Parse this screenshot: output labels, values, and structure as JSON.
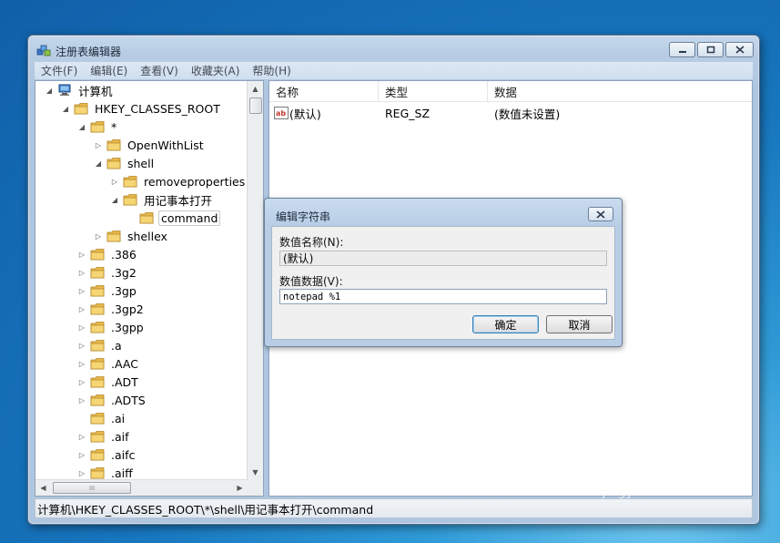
{
  "window": {
    "title": "注册表编辑器",
    "menu": [
      "文件(F)",
      "编辑(E)",
      "查看(V)",
      "收藏夹(A)",
      "帮助(H)"
    ]
  },
  "tree": [
    {
      "label": "计算机",
      "expander": "◢",
      "icon": "computer",
      "depth": 0
    },
    {
      "label": "HKEY_CLASSES_ROOT",
      "expander": "◢",
      "icon": "folder",
      "depth": 1
    },
    {
      "label": "*",
      "expander": "◢",
      "icon": "folder",
      "depth": 2
    },
    {
      "label": "OpenWithList",
      "expander": "▷",
      "icon": "folder",
      "depth": 3
    },
    {
      "label": "shell",
      "expander": "◢",
      "icon": "folder",
      "depth": 3
    },
    {
      "label": "removeproperties",
      "expander": "▷",
      "icon": "folder",
      "depth": 4
    },
    {
      "label": "用记事本打开",
      "expander": "◢",
      "icon": "folder",
      "depth": 4
    },
    {
      "label": "command",
      "expander": "",
      "icon": "folder",
      "depth": 5,
      "selected": true
    },
    {
      "label": "shellex",
      "expander": "▷",
      "icon": "folder",
      "depth": 3
    },
    {
      "label": ".386",
      "expander": "▷",
      "icon": "folder",
      "depth": 2
    },
    {
      "label": ".3g2",
      "expander": "▷",
      "icon": "folder",
      "depth": 2
    },
    {
      "label": ".3gp",
      "expander": "▷",
      "icon": "folder",
      "depth": 2
    },
    {
      "label": ".3gp2",
      "expander": "▷",
      "icon": "folder",
      "depth": 2
    },
    {
      "label": ".3gpp",
      "expander": "▷",
      "icon": "folder",
      "depth": 2
    },
    {
      "label": ".a",
      "expander": "▷",
      "icon": "folder",
      "depth": 2
    },
    {
      "label": ".AAC",
      "expander": "▷",
      "icon": "folder",
      "depth": 2
    },
    {
      "label": ".ADT",
      "expander": "▷",
      "icon": "folder",
      "depth": 2
    },
    {
      "label": ".ADTS",
      "expander": "▷",
      "icon": "folder",
      "depth": 2
    },
    {
      "label": ".ai",
      "expander": "",
      "icon": "folder",
      "depth": 2
    },
    {
      "label": ".aif",
      "expander": "▷",
      "icon": "folder",
      "depth": 2
    },
    {
      "label": ".aifc",
      "expander": "▷",
      "icon": "folder",
      "depth": 2
    },
    {
      "label": ".aiff",
      "expander": "▷",
      "icon": "folder",
      "depth": 2
    }
  ],
  "hscroll_thumb_glyph": "III",
  "list": {
    "headers": [
      "名称",
      "类型",
      "数据"
    ],
    "rows": [
      {
        "name": "(默认)",
        "type": "REG_SZ",
        "data": "(数值未设置)"
      }
    ]
  },
  "statusbar": "计算机\\HKEY_CLASSES_ROOT\\*\\shell\\用记事本打开\\command",
  "dialog": {
    "title": "编辑字符串",
    "name_label": "数值名称(N):",
    "name_value": "(默认)",
    "data_label": "数值数据(V):",
    "data_value": "notepad %1",
    "ok": "确定",
    "cancel": "取消"
  },
  "watermark": {
    "logo": "Baidu",
    "logo_cn": "经验",
    "sub": "jingyan.baidu.com"
  }
}
